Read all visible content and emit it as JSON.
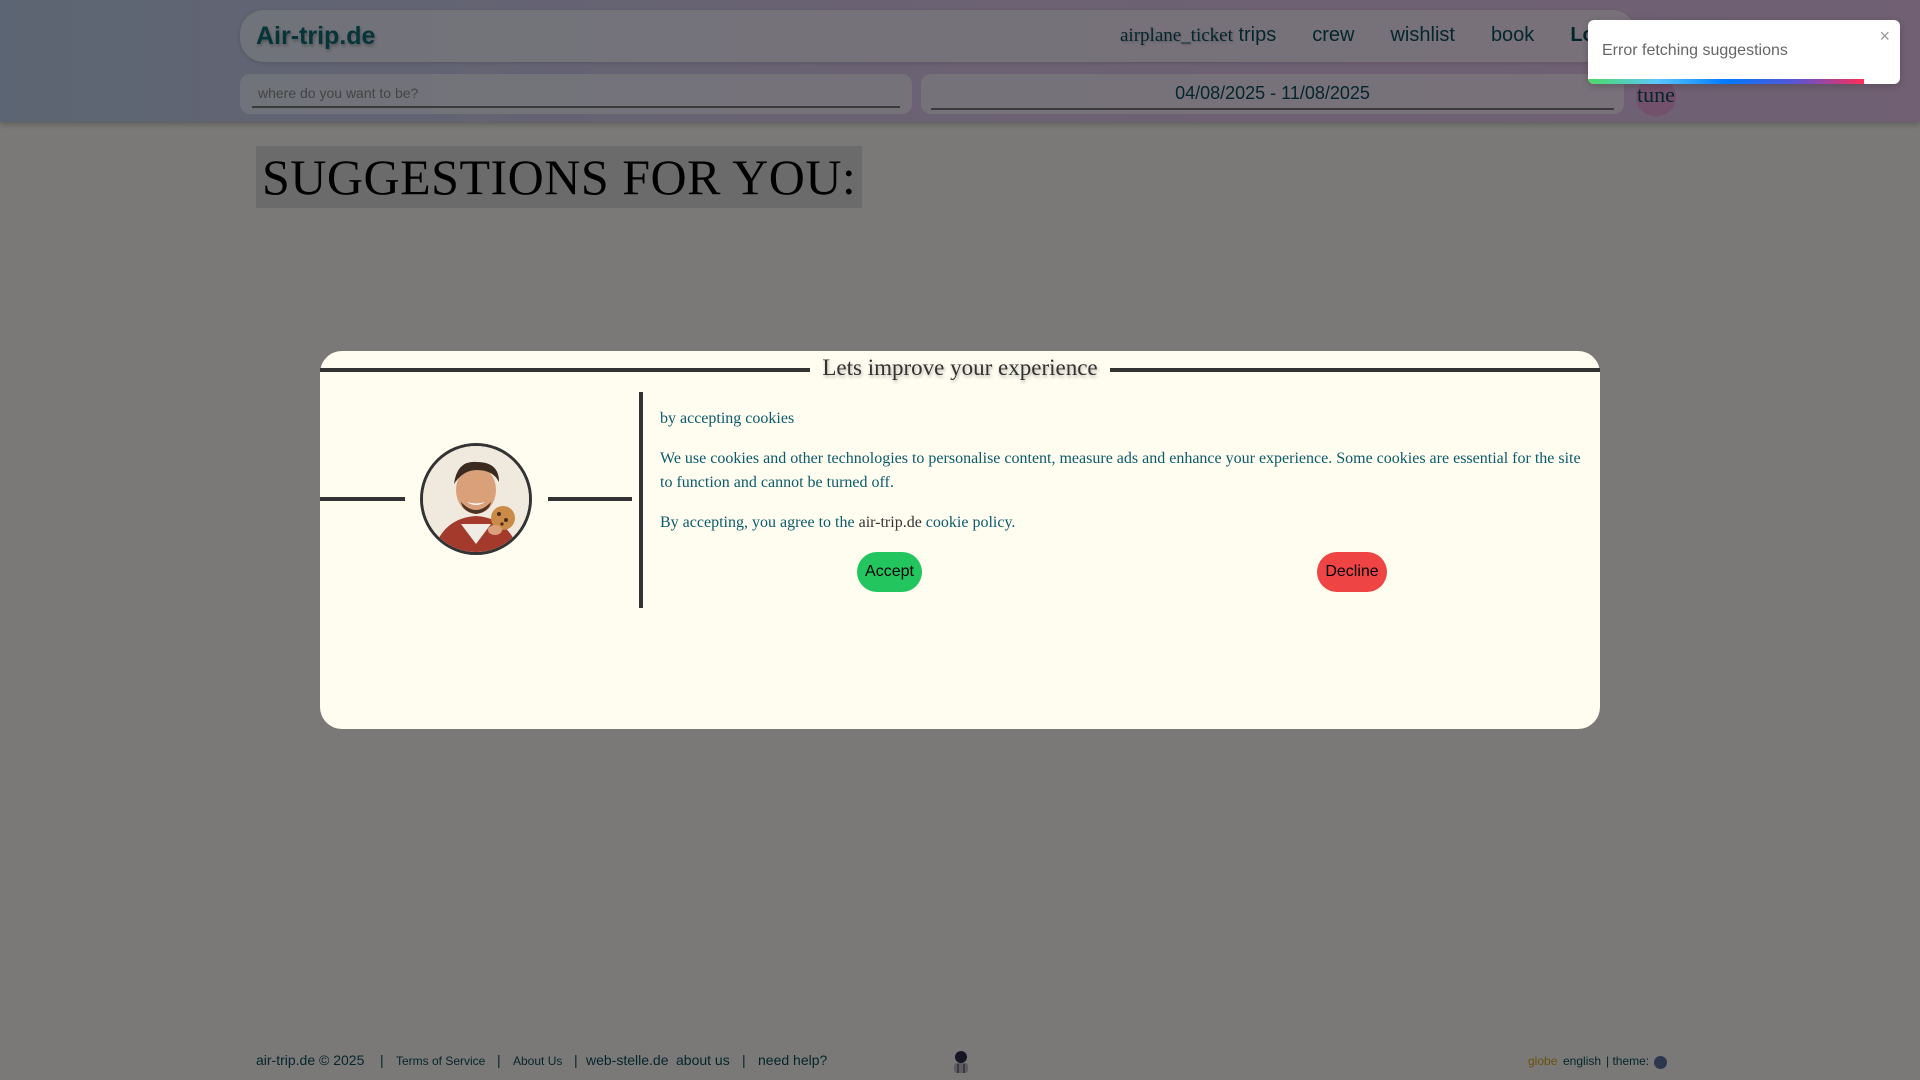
{
  "header": {
    "brand": "Air-trip.de",
    "nav": {
      "trips_icon": "airplane_ticket",
      "trips": "trips",
      "crew": "crew",
      "wishlist": "wishlist",
      "book": "book",
      "login": "Lo"
    },
    "search_placeholder": "where do you want to be?",
    "date_range": "04/08/2025 - 11/08/2025",
    "tune_icon": "tune"
  },
  "main": {
    "title": "SUGGESTIONS FOR YOU:"
  },
  "toast": {
    "message": "Error fetching suggestions",
    "close": "×"
  },
  "cookie_modal": {
    "heading": "Lets improve your experience",
    "line1": "by accepting cookies",
    "line2": "We use cookies and other technologies to personalise content, measure ads and enhance your experience. Some cookies are essential for the site to function and cannot be turned off.",
    "line3_prefix": "By accepting, you agree to the",
    "line3_site": "air-trip.de",
    "line3_link": "cookie policy.",
    "accept": "Accept",
    "decline": "Decline"
  },
  "footer": {
    "copyright": "air-trip.de © 2025",
    "sep": "|",
    "terms": "Terms of Service",
    "about_us_small": "About Us",
    "webstelle": "web-stelle.de",
    "about_us": "about us",
    "help": "need help?",
    "globe_icon": "globe",
    "language": "english",
    "theme": "| theme:"
  }
}
